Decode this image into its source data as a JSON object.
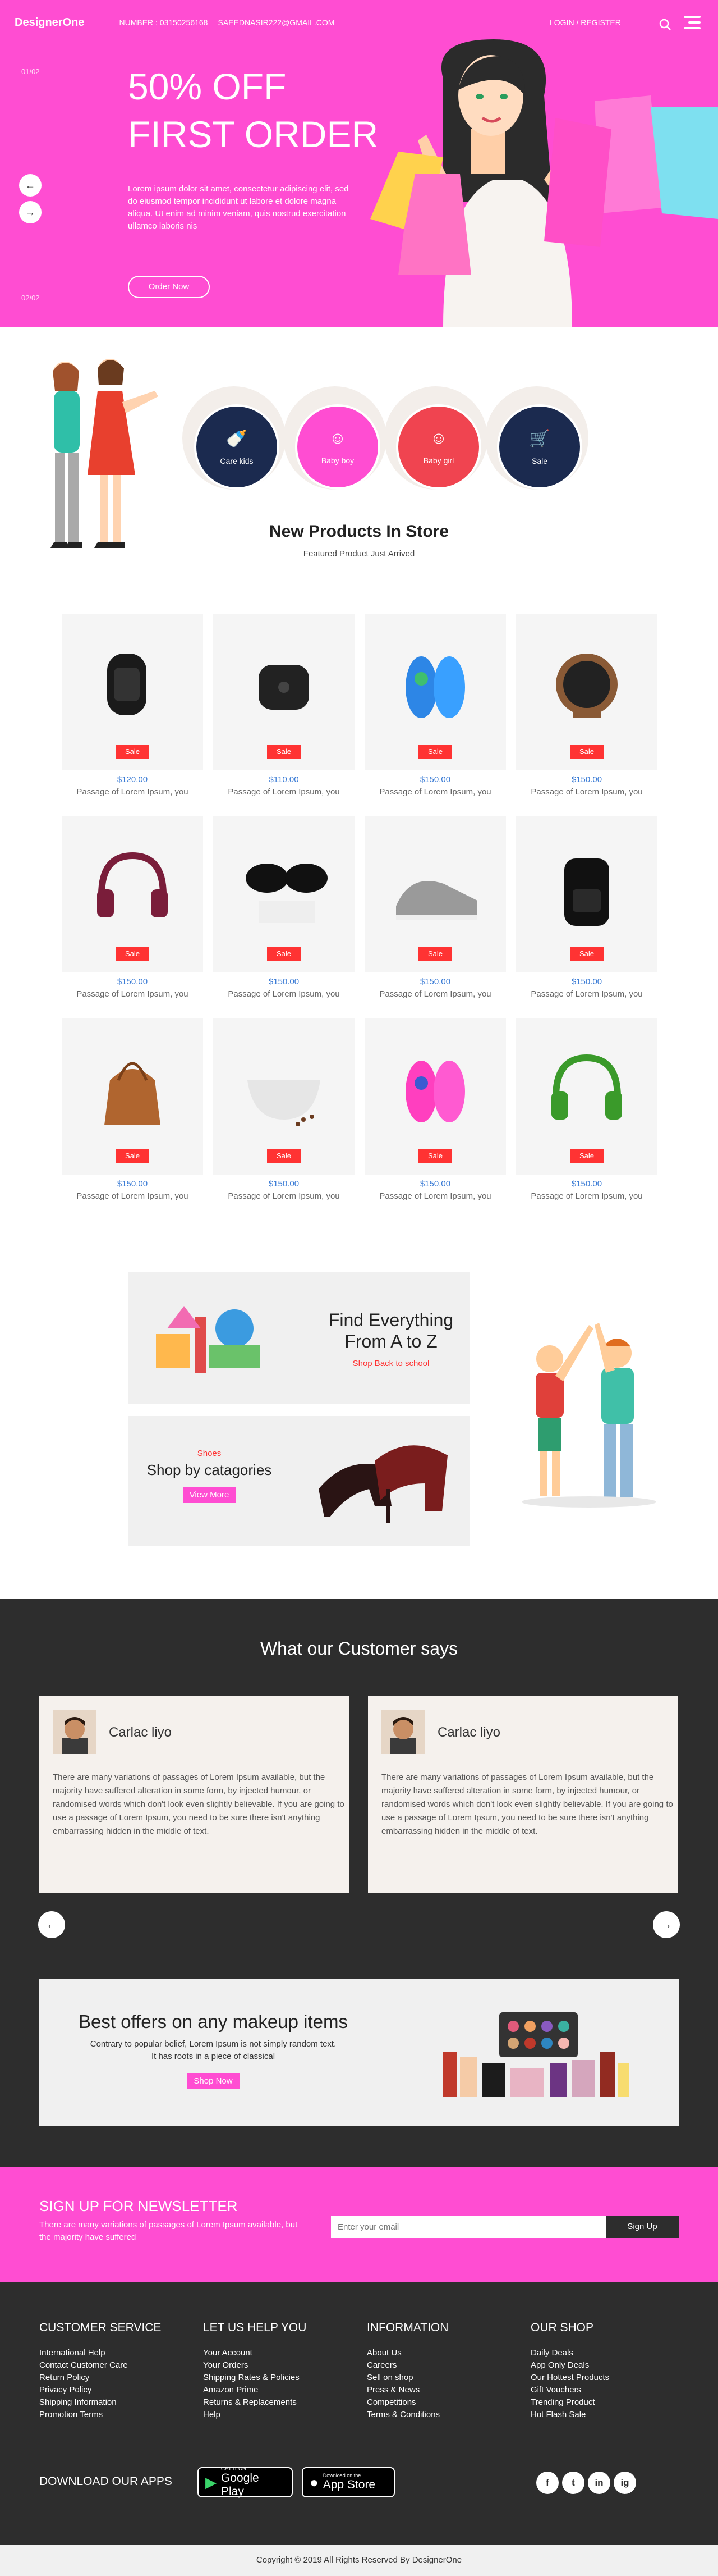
{
  "header": {
    "logo": "DesignerOne",
    "number": "NUMBER : 03150256168",
    "email": "SAEEDNASIR222@GMAIL.COM",
    "login": "LOGIN / REGISTER"
  },
  "hero": {
    "slide_top": "01/02",
    "slide_bottom": "02/02",
    "title_line1": "50% OFF",
    "title_line2": "FIRST ORDER",
    "text": "Lorem ipsum dolor sit amet, consectetur adipiscing elit, sed do eiusmod tempor incididunt ut labore et dolore magna aliqua. Ut enim ad minim veniam, quis nostrud exercitation ullamco laboris nis",
    "button": "Order Now"
  },
  "categories": {
    "items": [
      {
        "label": "Care kids",
        "color": "#1b2a4f"
      },
      {
        "label": "Baby boy",
        "color": "#ff4dd2"
      },
      {
        "label": "Baby girl",
        "color": "#f04450"
      },
      {
        "label": "Sale",
        "color": "#1b2a4f"
      }
    ],
    "title": "New Products In Store",
    "subtitle": "Featured Product Just Arrived"
  },
  "products": [
    {
      "name": "smart band",
      "price": "$120.00",
      "badge": "Sale",
      "desc": "Passage of Lorem Ipsum, you"
    },
    {
      "name": "speaker",
      "price": "$110.00",
      "badge": "Sale",
      "desc": "Passage of Lorem Ipsum, you"
    },
    {
      "name": "blue slippers",
      "price": "$150.00",
      "badge": "Sale",
      "desc": "Passage of Lorem Ipsum, you"
    },
    {
      "name": "desk fan",
      "price": "$150.00",
      "badge": "Sale",
      "desc": "Passage of Lorem Ipsum, you"
    },
    {
      "name": "headphones",
      "price": "$150.00",
      "badge": "Sale",
      "desc": "Passage of Lorem Ipsum, you"
    },
    {
      "name": "sunglasses",
      "price": "$150.00",
      "badge": "Sale",
      "desc": "Passage of Lorem Ipsum, you"
    },
    {
      "name": "sneaker",
      "price": "$150.00",
      "badge": "Sale",
      "desc": "Passage of Lorem Ipsum, you"
    },
    {
      "name": "backpack",
      "price": "$150.00",
      "badge": "Sale",
      "desc": "Passage of Lorem Ipsum, you"
    },
    {
      "name": "leather bag",
      "price": "$150.00",
      "badge": "Sale",
      "desc": "Passage of Lorem Ipsum, you"
    },
    {
      "name": "mortar",
      "price": "$150.00",
      "badge": "Sale",
      "desc": "Passage of Lorem Ipsum, you"
    },
    {
      "name": "pink slippers",
      "price": "$150.00",
      "badge": "Sale",
      "desc": "Passage of Lorem Ipsum, you"
    },
    {
      "name": "green headphones",
      "price": "$150.00",
      "badge": "Sale",
      "desc": "Passage of Lorem Ipsum, you"
    }
  ],
  "promo": {
    "az_title_1": "Find Everything",
    "az_title_2": "From A to Z",
    "az_link": "Shop Back to school",
    "shoes_label": "Shoes",
    "shoes_title": "Shop by catagories",
    "shoes_button": "View More"
  },
  "testimonials": {
    "title": "What our Customer says",
    "cards": [
      {
        "name": "Carlac liyo",
        "text": "There are many variations of passages of Lorem Ipsum available, but the majority have suffered alteration in some form, by injected humour, or randomised words which don't look even slightly believable. If you are going to use a passage of Lorem Ipsum, you need to be sure there isn't anything embarrassing hidden in the middle of text."
      },
      {
        "name": "Carlac liyo",
        "text": "There are many variations of passages of Lorem Ipsum available, but the majority have suffered alteration in some form, by injected humour, or randomised words which don't look even slightly believable. If you are going to use a passage of Lorem Ipsum, you need to be sure there isn't anything embarrassing hidden in the middle of text."
      }
    ]
  },
  "offers": {
    "title": "Best offers on any makeup items",
    "text": "Contrary to popular belief, Lorem Ipsum is not simply random text. It has roots in a piece of classical",
    "button": "Shop Now"
  },
  "newsletter": {
    "title": "SIGN UP FOR NEWSLETTER",
    "text": "There are many variations of passages of Lorem Ipsum available, but the majority have suffered",
    "placeholder": "Enter your email",
    "button": "Sign Up"
  },
  "footer": {
    "columns": [
      {
        "title": "CUSTOMER SERVICE",
        "links": [
          "International Help",
          "Contact Customer Care",
          "Return Policy",
          "Privacy Policy",
          "Shipping Information",
          "Promotion Terms"
        ]
      },
      {
        "title": "LET US HELP YOU",
        "links": [
          "Your Account",
          "Your Orders",
          "Shipping Rates & Policies",
          "Amazon Prime",
          "Returns & Replacements",
          "Help"
        ]
      },
      {
        "title": "INFORMATION",
        "links": [
          "About Us",
          "Careers",
          "Sell on shop",
          "Press & News",
          "Competitions",
          "Terms & Conditions"
        ]
      },
      {
        "title": "OUR SHOP",
        "links": [
          "Daily Deals",
          "App Only Deals",
          "Our Hottest Products",
          "Gift Vouchers",
          "Trending Product",
          "Hot Flash Sale"
        ]
      }
    ],
    "apps_label": "DOWNLOAD OUR APPS",
    "google_small": "GET IT ON",
    "google_big": "Google Play",
    "apple_small": "Download on the",
    "apple_big": "App Store",
    "social": [
      "f",
      "t",
      "in",
      "ig"
    ],
    "copyright": "Copyright © 2019 All Rights Reserved By DesignerOne"
  }
}
